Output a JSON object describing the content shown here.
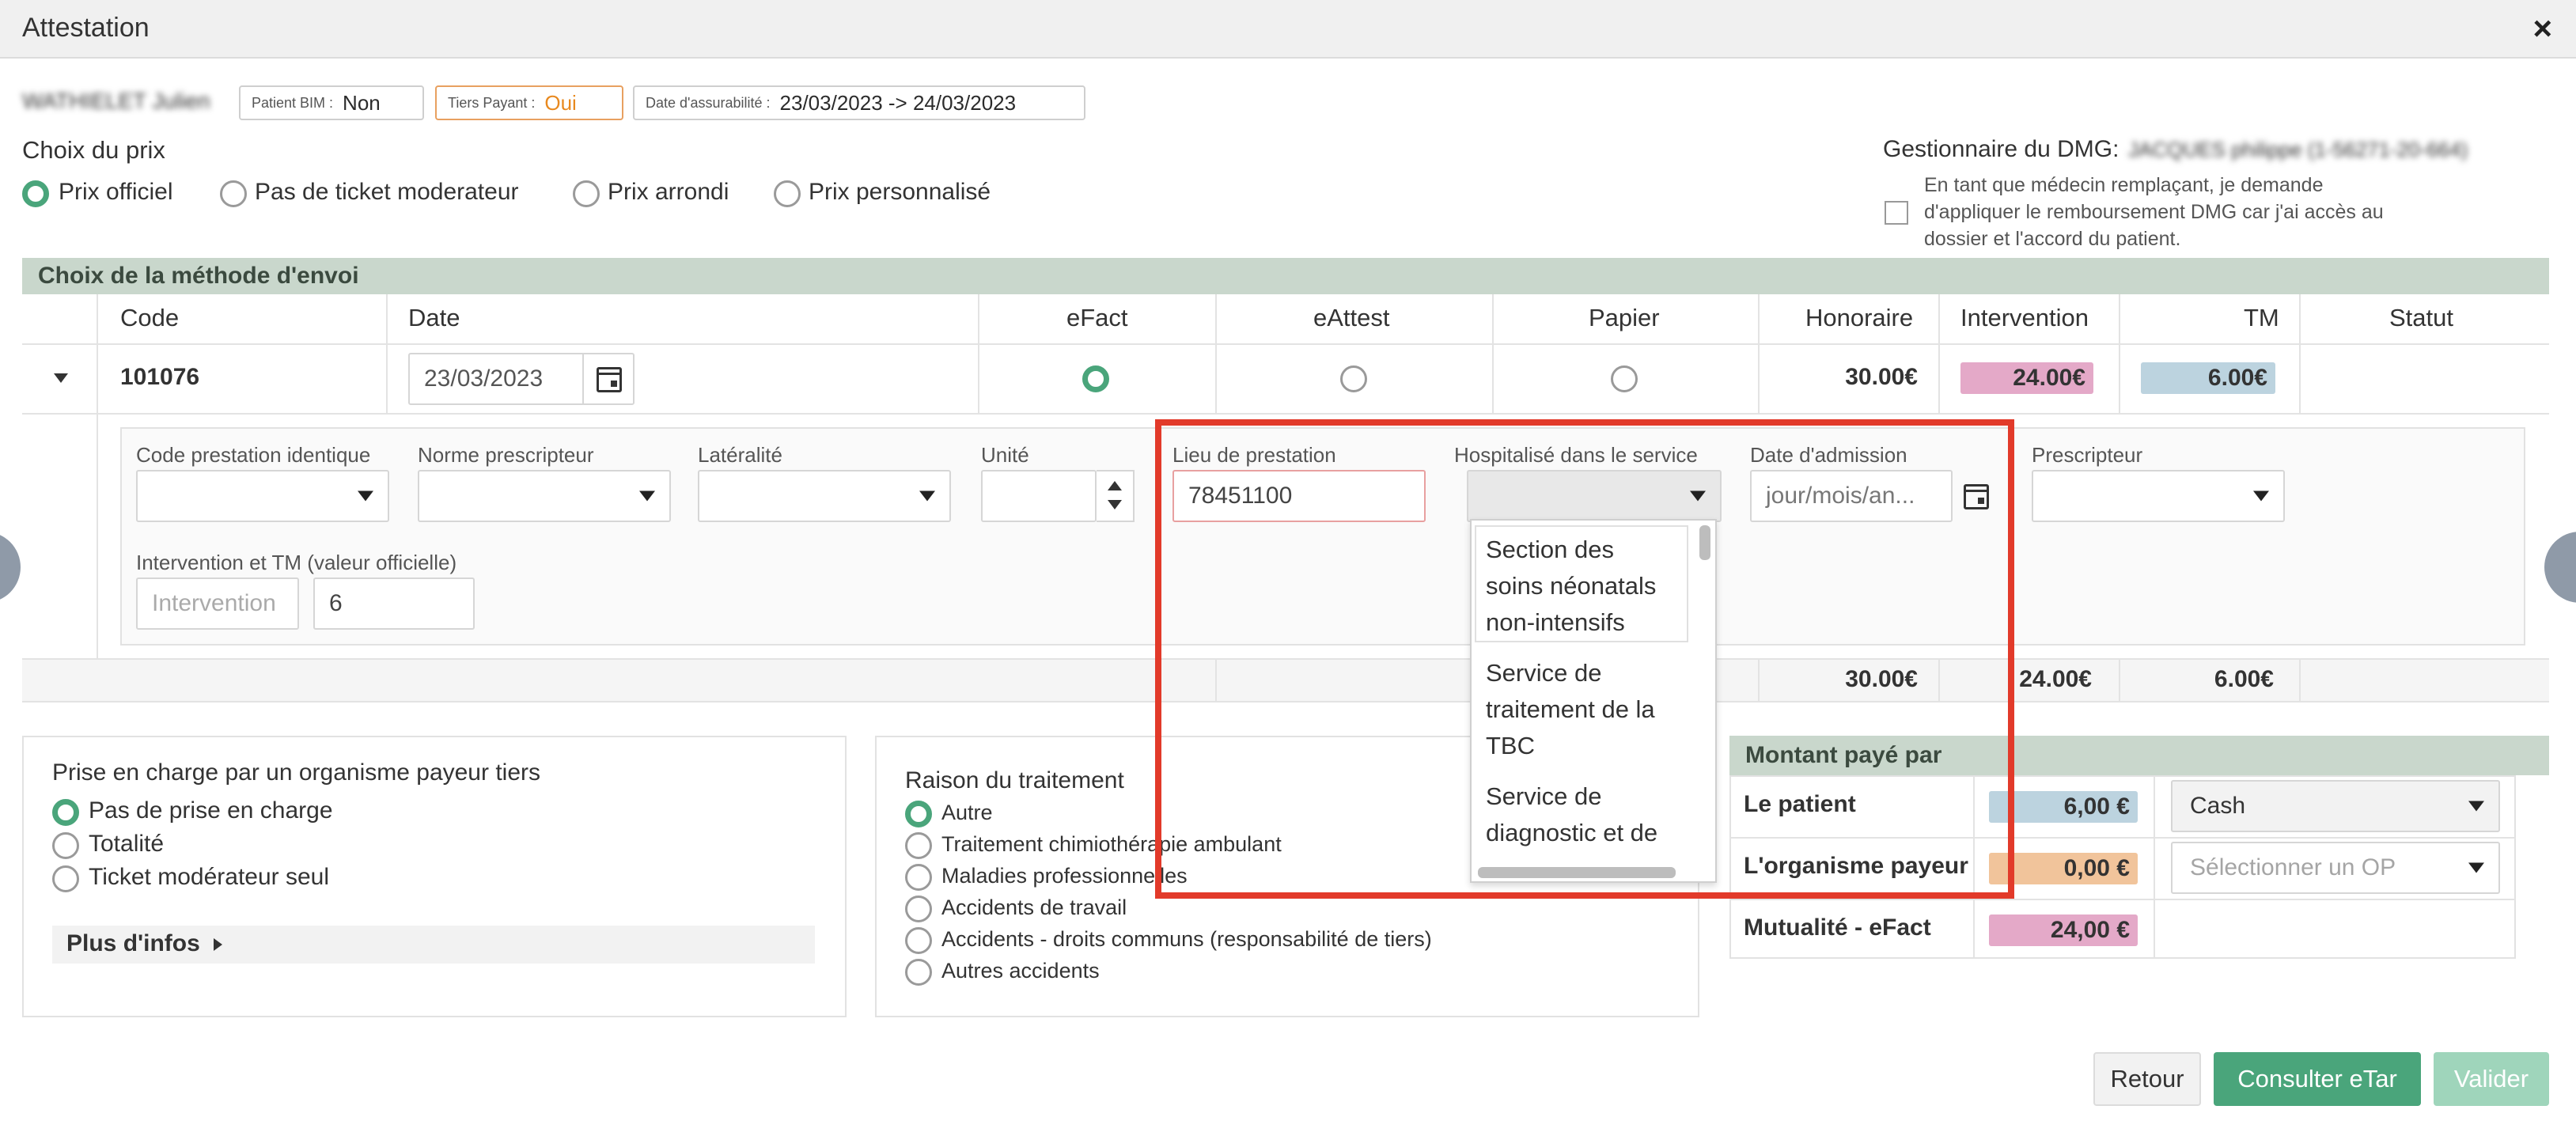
{
  "window": {
    "title": "Attestation",
    "close_icon": "×"
  },
  "patient": {
    "name": "WATHIELET Julien",
    "bim_label": "Patient BIM :",
    "bim_value": "Non",
    "tiers_label": "Tiers Payant :",
    "tiers_value": "Oui",
    "assur_label": "Date d'assurabilité :",
    "assur_value": "23/03/2023 -> 24/03/2023"
  },
  "price": {
    "heading": "Choix du prix",
    "options": [
      "Prix officiel",
      "Pas de ticket moderateur",
      "Prix arrondi",
      "Prix personnalisé"
    ],
    "selected": "Prix officiel"
  },
  "dmg": {
    "label": "Gestionnaire du DMG:",
    "value": "JACQUES philippe (1-56271-20-664)",
    "checkbox_text_1": "En tant que médecin remplaçant, je demande",
    "checkbox_text_2": "d'appliquer le remboursement DMG car j'ai accès au",
    "checkbox_text_3": "dossier et l'accord du patient."
  },
  "methods": {
    "heading": "Choix de la méthode d'envoi",
    "columns": [
      "Code",
      "Date",
      "eFact",
      "eAttest",
      "Papier",
      "Honoraire",
      "Intervention",
      "TM",
      "Statut"
    ],
    "row": {
      "code": "101076",
      "date": "23/03/2023",
      "honoraire": "30.00€",
      "intervention": "24.00€",
      "tm": "6.00€"
    },
    "totals": {
      "honoraire": "30.00€",
      "intervention": "24.00€",
      "tm": "6.00€"
    }
  },
  "details": {
    "code_prest_label": "Code prestation identique",
    "norme_label": "Norme prescripteur",
    "lateralite_label": "Latéralité",
    "unite_label": "Unité",
    "lieu_label": "Lieu de prestation",
    "lieu_value": "78451100",
    "hosp_label": "Hospitalisé dans le service",
    "admission_label": "Date d'admission",
    "admission_placeholder": "jour/mois/an...",
    "prescripteur_label": "Prescripteur",
    "interv_label": "Intervention et TM (valeur officielle)",
    "interv_placeholder": "Intervention",
    "tm_value": "6"
  },
  "hosp_dropdown": {
    "options": [
      [
        "Section des",
        "soins néonatals",
        "non-intensifs"
      ],
      [
        "Service de",
        "traitement de la",
        "TBC"
      ],
      [
        "Service de",
        "diagnostic et de"
      ]
    ]
  },
  "tiers": {
    "heading": "Prise en charge par un organisme payeur tiers",
    "options": [
      "Pas de prise en charge",
      "Totalité",
      "Ticket modérateur seul"
    ],
    "more": "Plus d'infos"
  },
  "raison": {
    "heading": "Raison du traitement",
    "options": [
      "Autre",
      "Traitement chimiothérapie ambulant",
      "Maladies professionnelles",
      "Accidents de travail",
      "Accidents - droits communs (responsabilité de tiers)",
      "Autres accidents"
    ]
  },
  "montant": {
    "heading": "Montant payé par",
    "rows": [
      {
        "label": "Le patient",
        "value": "6,00 €",
        "select": "Cash"
      },
      {
        "label": "L'organisme payeur",
        "value": "0,00 €",
        "select": "Sélectionner un OP"
      },
      {
        "label": "Mutualité - eFact",
        "value": "24,00 €"
      }
    ]
  },
  "buttons": {
    "retour": "Retour",
    "etar": "Consulter eTar",
    "valider": "Valider"
  },
  "colors": {
    "accent": "#4aa57b",
    "intervention": "#e4a9c8",
    "tm": "#bcd3df",
    "op": "#f1c49b",
    "highlight": "#e23a2a"
  }
}
